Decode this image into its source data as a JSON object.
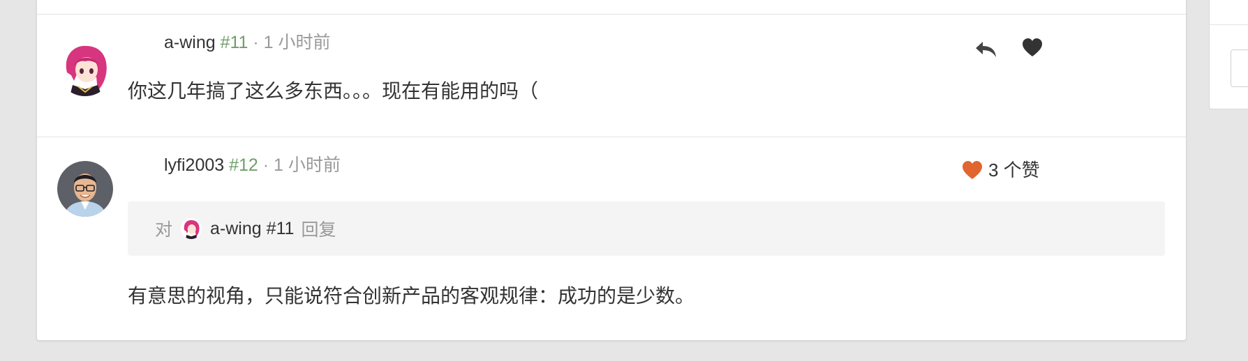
{
  "comments": [
    {
      "username": "a-wing",
      "floor": "#11",
      "time": " · 1 小时前",
      "text": "你这几年搞了这么多东西。。。现在有能用的吗（",
      "actions": {
        "reply_icon": "reply-icon",
        "like_icon": "heart-icon"
      }
    },
    {
      "username": "lyfi2003",
      "floor": "#12",
      "time": " · 1 小时前",
      "likes": "3 个赞",
      "reply_to": {
        "prefix": "对",
        "user": "a-wing #11",
        "suffix": "回复"
      },
      "text": "有意思的视角，只能说符合创新产品的客观规律：成功的是少数。"
    }
  ],
  "colors": {
    "floor": "#6f9f69",
    "liked_heart": "#e0652f",
    "meta_gray": "#999999",
    "background": "#e6e6e6"
  }
}
